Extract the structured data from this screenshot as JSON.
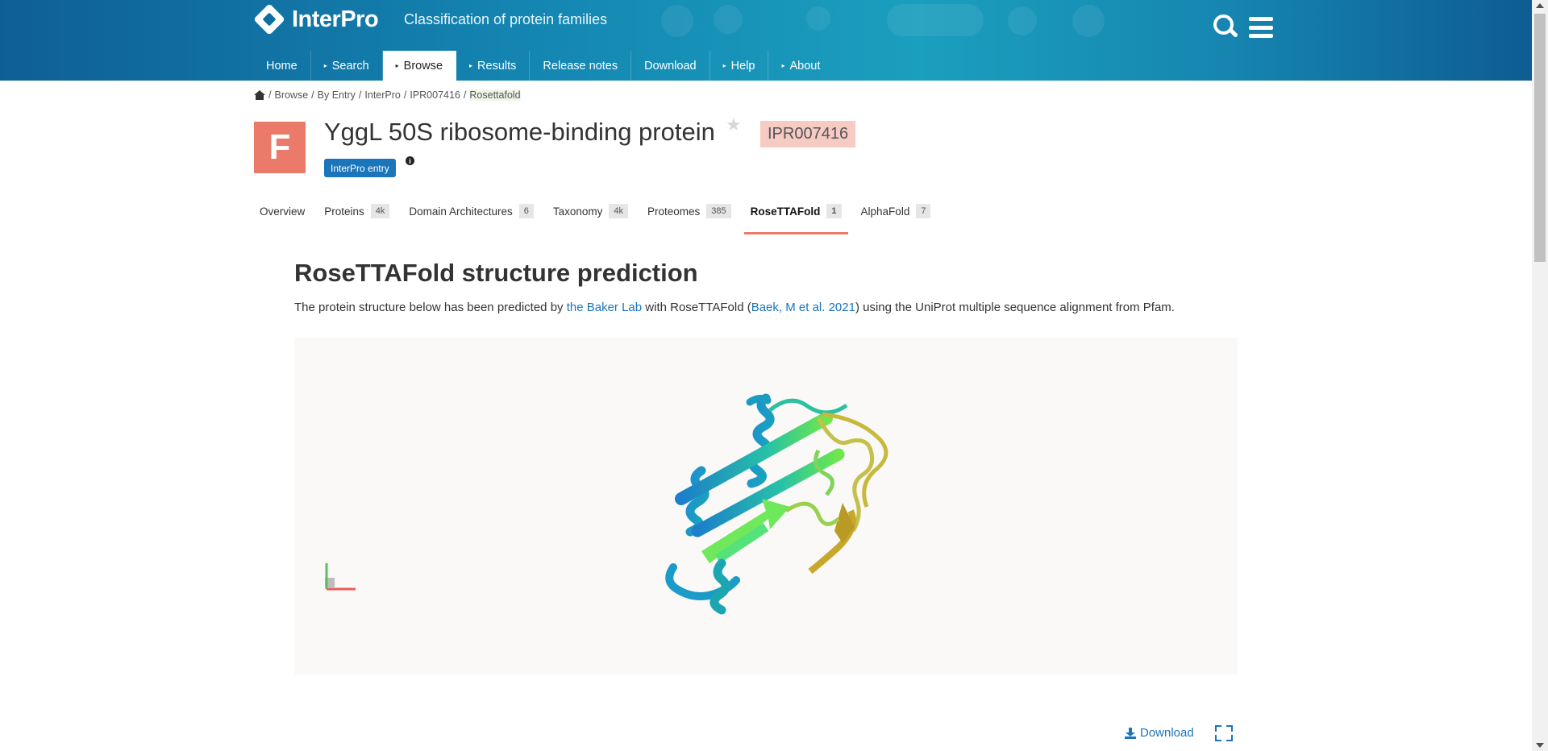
{
  "brand": {
    "name": "InterPro",
    "tagline": "Classification of protein families"
  },
  "nav": [
    {
      "label": "Home",
      "has_arrow": false,
      "active": false
    },
    {
      "label": "Search",
      "has_arrow": true,
      "active": false
    },
    {
      "label": "Browse",
      "has_arrow": true,
      "active": true
    },
    {
      "label": "Results",
      "has_arrow": true,
      "active": false
    },
    {
      "label": "Release notes",
      "has_arrow": false,
      "active": false
    },
    {
      "label": "Download",
      "has_arrow": false,
      "active": false
    },
    {
      "label": "Help",
      "has_arrow": true,
      "active": false
    },
    {
      "label": "About",
      "has_arrow": true,
      "active": false
    }
  ],
  "breadcrumb": {
    "items": [
      "Browse",
      "By Entry",
      "InterPro",
      "IPR007416"
    ],
    "current": "Rosettafold",
    "separator": "/"
  },
  "entry": {
    "type_letter": "F",
    "title": "YggL 50S ribosome-binding protein",
    "accession": "IPR007416",
    "source_label": "InterPro entry",
    "info_glyph": "i",
    "star_glyph": "★"
  },
  "tabs": [
    {
      "label": "Overview",
      "count": ""
    },
    {
      "label": "Proteins",
      "count": "4k"
    },
    {
      "label": "Domain Architectures",
      "count": "6"
    },
    {
      "label": "Taxonomy",
      "count": "4k"
    },
    {
      "label": "Proteomes",
      "count": "385"
    },
    {
      "label": "RoseTTAFold",
      "count": "1",
      "active": true
    },
    {
      "label": "AlphaFold",
      "count": "7"
    }
  ],
  "content": {
    "heading": "RoseTTAFold structure prediction",
    "desc_before_lab": "The protein structure below has been predicted by ",
    "lab_link": "the Baker Lab",
    "desc_middle": " with RoseTTAFold (",
    "citation_link": "Baek, M et al. 2021",
    "desc_after": ") using the UniProt multiple sequence alignment from Pfam.",
    "download_label": "Download"
  },
  "colors": {
    "header_blue": "#0e5f95",
    "family_badge": "#ec7a6a",
    "accession_bg": "#f6cbc4",
    "link": "#1a75bb",
    "active_tab_underline": "#ec7a6a"
  },
  "icons": [
    "home-icon",
    "search-icon",
    "menu-icon",
    "star-icon",
    "info-icon",
    "download-icon",
    "fullscreen-icon"
  ]
}
